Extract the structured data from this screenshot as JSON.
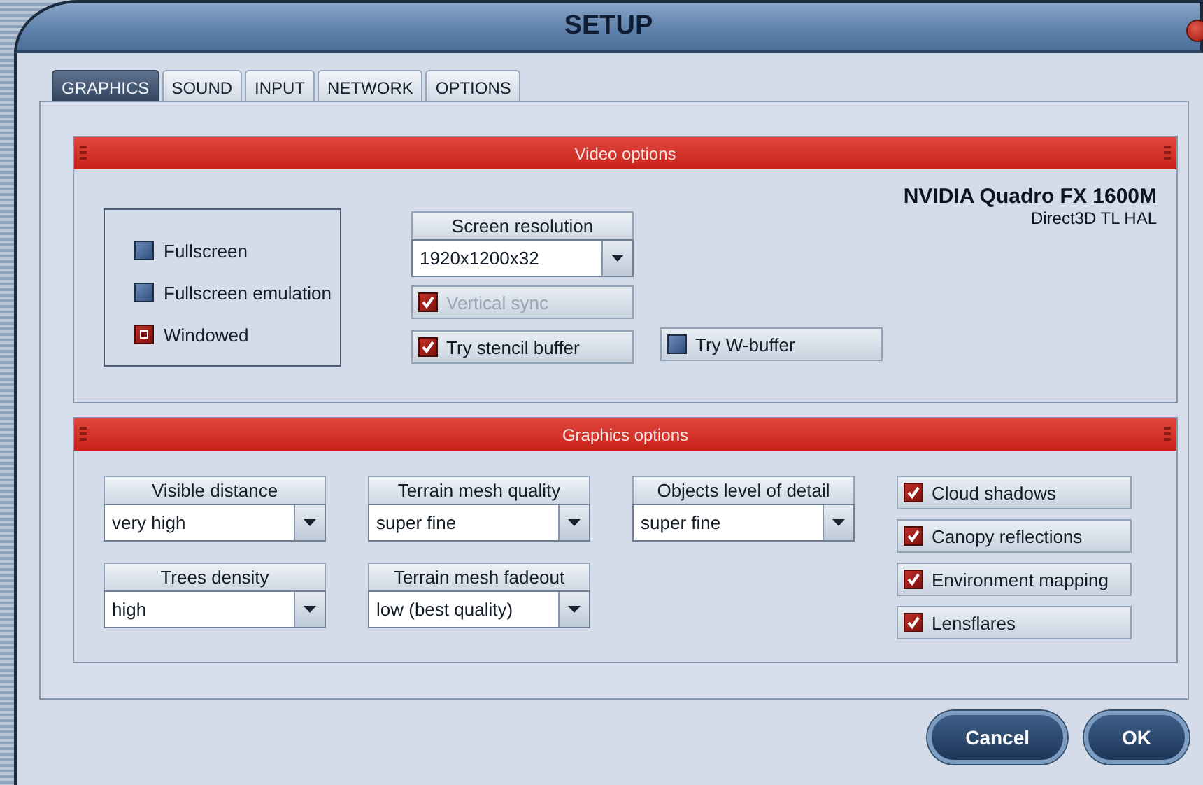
{
  "window": {
    "title": "SETUP"
  },
  "tabs": [
    {
      "label": "GRAPHICS",
      "selected": true
    },
    {
      "label": "SOUND",
      "selected": false
    },
    {
      "label": "INPUT",
      "selected": false
    },
    {
      "label": "NETWORK",
      "selected": false
    },
    {
      "label": "OPTIONS",
      "selected": false
    }
  ],
  "video_options": {
    "title": "Video options",
    "gpu_name": "NVIDIA Quadro FX 1600M",
    "gpu_renderer": "Direct3D TL HAL",
    "display_modes": [
      {
        "label": "Fullscreen",
        "selected": false
      },
      {
        "label": "Fullscreen emulation",
        "selected": false
      },
      {
        "label": "Windowed",
        "selected": true
      }
    ],
    "screen_resolution": {
      "label": "Screen resolution",
      "value": "1920x1200x32"
    },
    "toggles": [
      {
        "label": "Vertical sync",
        "checked": true,
        "disabled": true
      },
      {
        "label": "Try stencil buffer",
        "checked": true,
        "disabled": false
      },
      {
        "label": "Try W-buffer",
        "checked": false,
        "disabled": false
      }
    ]
  },
  "graphics_options": {
    "title": "Graphics options",
    "selects": [
      {
        "label": "Visible distance",
        "value": "very high"
      },
      {
        "label": "Terrain mesh quality",
        "value": "super fine"
      },
      {
        "label": "Objects level of detail",
        "value": "super fine"
      },
      {
        "label": "Trees density",
        "value": "high"
      },
      {
        "label": "Terrain mesh fadeout",
        "value": "low (best quality)"
      }
    ],
    "toggles": [
      {
        "label": "Cloud shadows",
        "checked": true,
        "disabled": false
      },
      {
        "label": "Canopy reflections",
        "checked": true,
        "disabled": false
      },
      {
        "label": "Environment mapping",
        "checked": true,
        "disabled": false
      },
      {
        "label": "Lensflares",
        "checked": true,
        "disabled": false
      }
    ]
  },
  "buttons": [
    {
      "label": "Cancel"
    },
    {
      "label": "OK"
    }
  ]
}
